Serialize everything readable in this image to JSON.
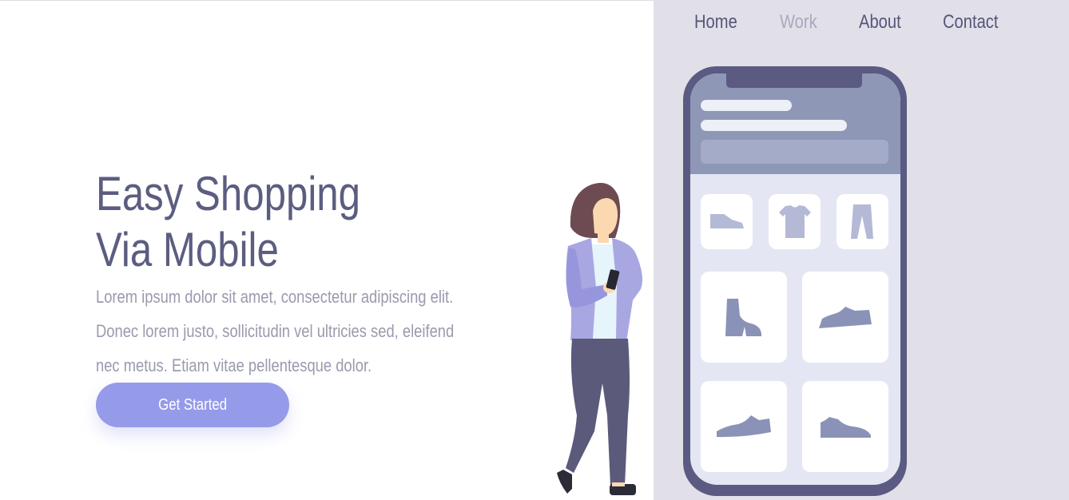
{
  "nav": {
    "items": [
      {
        "label": "Home",
        "active": false
      },
      {
        "label": "Work",
        "active": true
      },
      {
        "label": "About",
        "active": false
      },
      {
        "label": "Contact",
        "active": false
      }
    ]
  },
  "hero": {
    "title_line1": "Easy Shopping",
    "title_line2": "Via Mobile",
    "description": "Lorem ipsum dolor sit amet, consectetur adipiscing elit. Donec lorem justo, sollicitudin vel ultricies sed, eleifend nec metus. Etiam vitae pellentesque dolor.",
    "cta_label": "Get Started"
  },
  "illustration": {
    "phone_products": [
      "shoe-icon",
      "tshirt-icon",
      "pants-icon",
      "boot-icon",
      "sneaker-icon",
      "sneaker-icon",
      "sneaker-icon"
    ]
  },
  "colors": {
    "accent": "#959be8",
    "heading": "#5b5d80",
    "body_text": "#9a9aae",
    "panel_bg": "#e1e0e8",
    "phone_frame": "#5b5a82",
    "nav_active": "#a9a9bd"
  }
}
